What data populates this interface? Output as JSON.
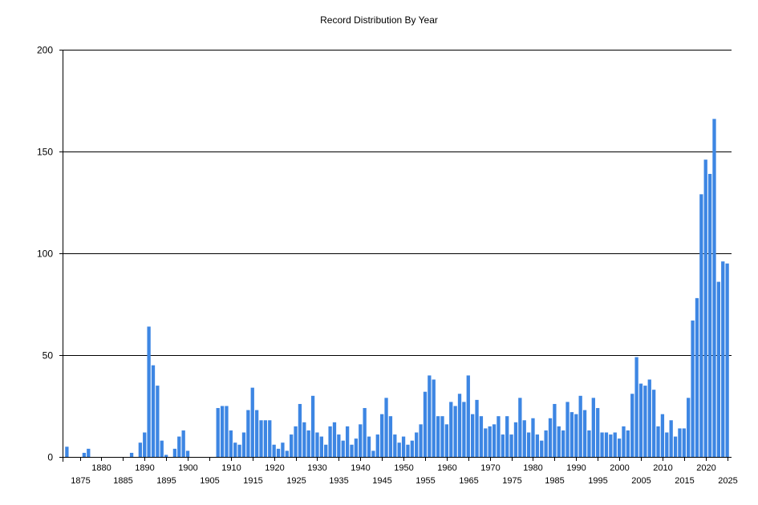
{
  "chart_data": {
    "type": "bar",
    "title": "Record Distribution By Year",
    "xlabel": "",
    "ylabel": "",
    "ylim": [
      0,
      200
    ],
    "yticks": [
      0,
      50,
      100,
      150,
      200
    ],
    "xlim": [
      1871,
      2026
    ],
    "xticks": [
      1875,
      1880,
      1885,
      1890,
      1895,
      1900,
      1905,
      1910,
      1915,
      1920,
      1925,
      1930,
      1935,
      1940,
      1945,
      1950,
      1955,
      1960,
      1965,
      1970,
      1975,
      1980,
      1985,
      1990,
      1995,
      2000,
      2005,
      2010,
      2015,
      2020,
      2025
    ],
    "grid": "horizontal",
    "legend": "none",
    "colors": {
      "bar": "#3d86e3",
      "axis": "#000000",
      "grid": "#000000"
    },
    "years": [
      1872,
      1876,
      1877,
      1887,
      1889,
      1890,
      1891,
      1892,
      1893,
      1894,
      1895,
      1897,
      1898,
      1899,
      1900,
      1907,
      1908,
      1909,
      1910,
      1911,
      1912,
      1913,
      1914,
      1915,
      1916,
      1917,
      1918,
      1919,
      1920,
      1921,
      1922,
      1923,
      1924,
      1925,
      1926,
      1927,
      1928,
      1929,
      1930,
      1931,
      1932,
      1933,
      1934,
      1935,
      1936,
      1937,
      1938,
      1939,
      1940,
      1941,
      1942,
      1943,
      1944,
      1945,
      1946,
      1947,
      1948,
      1949,
      1950,
      1951,
      1952,
      1953,
      1954,
      1955,
      1956,
      1957,
      1958,
      1959,
      1960,
      1961,
      1962,
      1963,
      1964,
      1965,
      1966,
      1967,
      1968,
      1969,
      1970,
      1971,
      1972,
      1973,
      1974,
      1975,
      1976,
      1977,
      1978,
      1979,
      1980,
      1981,
      1982,
      1983,
      1984,
      1985,
      1986,
      1987,
      1988,
      1989,
      1990,
      1991,
      1992,
      1993,
      1994,
      1995,
      1996,
      1997,
      1998,
      1999,
      2000,
      2001,
      2002,
      2003,
      2004,
      2005,
      2006,
      2007,
      2008,
      2009,
      2010,
      2011,
      2012,
      2013,
      2014,
      2015,
      2016,
      2017,
      2018,
      2019,
      2020,
      2021,
      2022,
      2023,
      2024,
      2025
    ],
    "values": [
      5,
      2,
      4,
      2,
      7,
      12,
      64,
      45,
      35,
      8,
      1,
      4,
      10,
      13,
      3,
      24,
      25,
      25,
      13,
      7,
      6,
      12,
      23,
      34,
      23,
      18,
      18,
      18,
      6,
      4,
      7,
      3,
      11,
      15,
      26,
      17,
      13,
      30,
      12,
      10,
      6,
      15,
      17,
      11,
      8,
      15,
      6,
      9,
      16,
      24,
      10,
      3,
      11,
      21,
      29,
      20,
      11,
      7,
      10,
      6,
      8,
      12,
      16,
      32,
      40,
      38,
      20,
      20,
      16,
      27,
      25,
      31,
      27,
      40,
      21,
      28,
      20,
      14,
      15,
      16,
      20,
      11,
      20,
      11,
      17,
      29,
      18,
      12,
      19,
      11,
      8,
      13,
      19,
      26,
      15,
      13,
      27,
      22,
      21,
      30,
      23,
      13,
      29,
      24,
      12,
      12,
      11,
      12,
      9,
      15,
      13,
      31,
      49,
      36,
      35,
      38,
      33,
      15,
      21,
      12,
      18,
      10,
      14,
      14,
      29,
      67,
      78,
      129,
      146,
      139,
      166,
      86,
      96,
      95,
      1
    ]
  }
}
